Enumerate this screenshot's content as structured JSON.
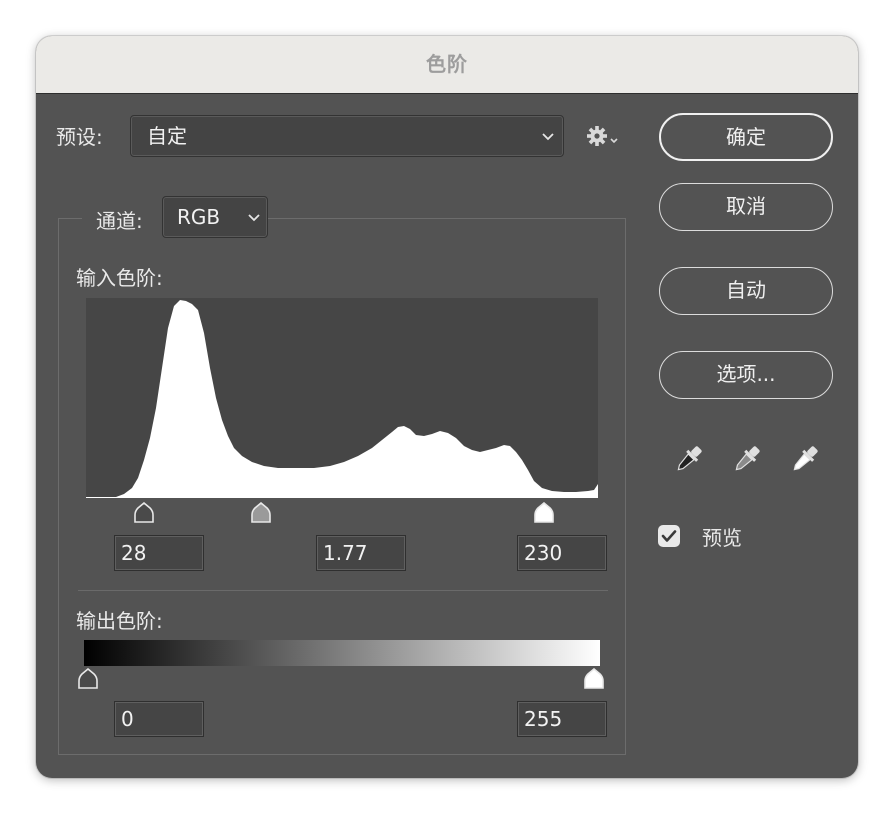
{
  "window": {
    "title": "色阶"
  },
  "preset": {
    "label": "预设:",
    "value": "自定",
    "gear_icon": "gear-icon"
  },
  "buttons": {
    "ok": "确定",
    "cancel": "取消",
    "auto": "自动",
    "options": "选项..."
  },
  "channel": {
    "label": "通道:",
    "value": "RGB"
  },
  "input_levels": {
    "label": "输入色阶:",
    "black": "28",
    "gamma": "1.77",
    "white": "230",
    "black_fraction": 0.11,
    "gamma_fraction": 0.35,
    "white_fraction": 0.9
  },
  "output_levels": {
    "label": "输出色阶:",
    "black": "0",
    "white": "255"
  },
  "preview": {
    "label": "预览",
    "checked": true
  },
  "eyedroppers": [
    "black-point-eyedropper-icon",
    "gray-point-eyedropper-icon",
    "white-point-eyedropper-icon"
  ],
  "colors": {
    "panel": "#535353",
    "titlebar": "#ebeae7",
    "histogram_bg": "#464646",
    "histogram_fill": "#ffffff"
  }
}
